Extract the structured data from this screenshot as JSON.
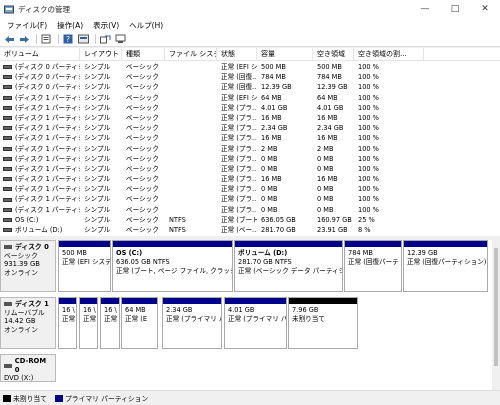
{
  "window": {
    "title": "ディスクの管理",
    "btn_min": "—",
    "btn_max": "□",
    "btn_close": "✕"
  },
  "menu": [
    {
      "label": "ファイル(F)"
    },
    {
      "label": "操作(A)"
    },
    {
      "label": "表示(V)"
    },
    {
      "label": "ヘルプ(H)"
    }
  ],
  "columns": [
    "ボリューム",
    "レイアウト",
    "種類",
    "ファイル システム",
    "状態",
    "容量",
    "空き領域",
    "空き領域の割..."
  ],
  "volumes": [
    {
      "c": [
        "(ディスク 0 パーティション 1)",
        "シンプル",
        "ベーシック",
        "",
        "正常 (EFI シ...",
        "500 MB",
        "500 MB",
        "100 %"
      ]
    },
    {
      "c": [
        "(ディスク 0 パーティション 4)",
        "シンプル",
        "ベーシック",
        "",
        "正常 (回復...",
        "784 MB",
        "784 MB",
        "100 %"
      ]
    },
    {
      "c": [
        "(ディスク 0 パーティション 5)",
        "シンプル",
        "ベーシック",
        "",
        "正常 (回復...",
        "12.39 GB",
        "12.39 GB",
        "100 %"
      ]
    },
    {
      "c": [
        "(ディスク 1 パーティション 1)",
        "シンプル",
        "ベーシック",
        "",
        "正常 (EFI シ...",
        "64 MB",
        "64 MB",
        "100 %"
      ]
    },
    {
      "c": [
        "(ディスク 1 パーティション 10)",
        "シンプル",
        "ベーシック",
        "",
        "正常 (プラ...",
        "4.01 GB",
        "4.01 GB",
        "100 %"
      ]
    },
    {
      "c": [
        "(ディスク 1 パーティション 11)",
        "シンプル",
        "ベーシック",
        "",
        "正常 (プラ...",
        "16 MB",
        "16 MB",
        "100 %"
      ]
    },
    {
      "c": [
        "(ディスク 1 パーティション 12)",
        "シンプル",
        "ベーシック",
        "",
        "正常 (プラ...",
        "2.34 GB",
        "2.34 GB",
        "100 %"
      ]
    },
    {
      "c": [
        "(ディスク 1 パーティション 2)",
        "シンプル",
        "ベーシック",
        "",
        "正常 (プラ...",
        "16 MB",
        "16 MB",
        "100 %"
      ]
    },
    {
      "c": [
        "(ディスク 1 パーティション 3)",
        "シンプル",
        "ベーシック",
        "",
        "正常 (プラ...",
        "2 MB",
        "2 MB",
        "100 %"
      ]
    },
    {
      "c": [
        "(ディスク 1 パーティション 4)",
        "シンプル",
        "ベーシック",
        "",
        "正常 (プラ...",
        "0 MB",
        "0 MB",
        "100 %"
      ]
    },
    {
      "c": [
        "(ディスク 1 パーティション 5)",
        "シンプル",
        "ベーシック",
        "",
        "正常 (プラ...",
        "0 MB",
        "0 MB",
        "100 %"
      ]
    },
    {
      "c": [
        "(ディスク 1 パーティション 6)",
        "シンプル",
        "ベーシック",
        "",
        "正常 (プラ...",
        "16 MB",
        "16 MB",
        "100 %"
      ]
    },
    {
      "c": [
        "(ディスク 1 パーティション 7)",
        "シンプル",
        "ベーシック",
        "",
        "正常 (プラ...",
        "0 MB",
        "0 MB",
        "100 %"
      ]
    },
    {
      "c": [
        "(ディスク 1 パーティション 8)",
        "シンプル",
        "ベーシック",
        "",
        "正常 (プラ...",
        "0 MB",
        "0 MB",
        "100 %"
      ]
    },
    {
      "c": [
        "(ディスク 1 パーティション 9)",
        "シンプル",
        "ベーシック",
        "",
        "正常 (プラ...",
        "0 MB",
        "0 MB",
        "100 %"
      ]
    },
    {
      "c": [
        "OS (C:)",
        "シンプル",
        "ベーシック",
        "NTFS",
        "正常 (ブート...",
        "636.05 GB",
        "160.97 GB",
        "25 %"
      ]
    },
    {
      "c": [
        "ボリューム (D:)",
        "シンプル",
        "ベーシック",
        "NTFS",
        "正常 (ベー...",
        "281.70 GB",
        "23.91 GB",
        "8 %"
      ]
    }
  ],
  "disks": [
    {
      "name": "ディスク 0",
      "lines": [
        "ベーシック",
        "931.39 GB",
        "オンライン"
      ],
      "partitions": [
        {
          "name": "",
          "lines": [
            "500 MB",
            "正常 (EFI システ"
          ],
          "fill": "primary"
        },
        {
          "name": "OS (C:)",
          "lines": [
            "636.05 GB NTFS",
            "正常 (ブート, ページ ファイル, クラッシュ ダ"
          ],
          "fill": "primary"
        },
        {
          "name": "ボリューム (D:)",
          "lines": [
            "281.70 GB NTFS",
            "正常 (ベーシック データ パーティション)"
          ],
          "fill": "primary"
        },
        {
          "name": "",
          "lines": [
            "784 MB",
            "正常 (回復パーテ"
          ],
          "fill": "primary"
        },
        {
          "name": "",
          "lines": [
            "12.39 GB",
            "正常 (回復パーティション)"
          ],
          "fill": "primary"
        }
      ]
    },
    {
      "name": "ディスク 1",
      "lines": [
        "リムーバブル",
        "14.42 GB",
        "オンライン"
      ],
      "partitions": [
        {
          "name": "",
          "lines": [
            "16 \\",
            "正常"
          ],
          "fill": "primary"
        },
        {
          "name": "",
          "lines": [
            "16 \\",
            "正常"
          ],
          "fill": "primary"
        },
        {
          "name": "",
          "lines": [
            "16 \\",
            "正常"
          ],
          "fill": "primary"
        },
        {
          "name": "",
          "lines": [
            "64 MB",
            "正常 (E"
          ],
          "fill": "primary"
        },
        {
          "name": "",
          "lines": [
            "2.34 GB",
            "正常 (プライマリ パ"
          ],
          "fill": "primary"
        },
        {
          "name": "",
          "lines": [
            "4.01 GB",
            "正常 (プライマリ パー"
          ],
          "fill": "primary"
        },
        {
          "name": "",
          "lines": [
            "7.96 GB",
            "未割り当て"
          ],
          "fill": "unallocated"
        }
      ]
    },
    {
      "name": "CD-ROM 0",
      "lines": [
        "DVD (X:)"
      ],
      "partitions": []
    }
  ],
  "legend": [
    {
      "label": "未割り当て",
      "color": "#000000"
    },
    {
      "label": "プライマリ パーティション",
      "color": "#00008b"
    }
  ],
  "colors": {
    "primary": "#00008b",
    "unallocated": "#000000"
  },
  "icons": [
    "disk-management-icon",
    "back-icon",
    "forward-icon",
    "properties-icon",
    "help-icon",
    "volume-icon",
    "refresh-icon",
    "connect-icon"
  ]
}
